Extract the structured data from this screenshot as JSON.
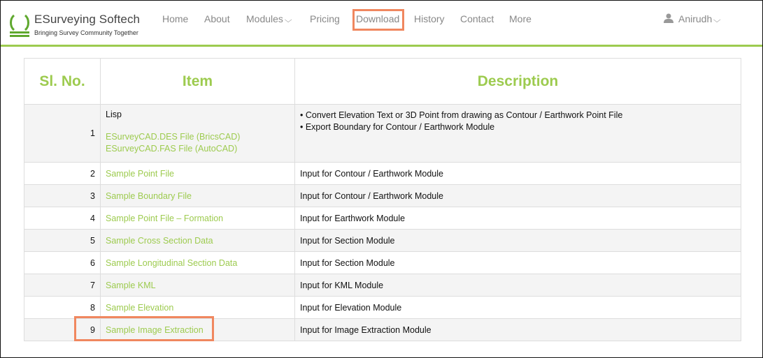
{
  "brand": {
    "title": "ESurveying Softech",
    "tagline": "Bringing Survey Community Together",
    "logo_icon": "omega-logo-icon",
    "accent_color": "#9dcb4f"
  },
  "nav": {
    "items": [
      {
        "label": "Home"
      },
      {
        "label": "About"
      },
      {
        "label": "Modules",
        "has_dropdown": true
      },
      {
        "label": "Pricing"
      },
      {
        "label": "Download",
        "highlighted": true
      },
      {
        "label": "History"
      },
      {
        "label": "Contact"
      },
      {
        "label": "More"
      }
    ],
    "user": {
      "name": "Anirudh",
      "icon": "user-icon",
      "has_dropdown": true
    },
    "chevron": "❯"
  },
  "table": {
    "headers": {
      "num": "Sl. No.",
      "item": "Item",
      "desc": "Description"
    },
    "first_row": {
      "num": "1",
      "label": "Lisp",
      "links": [
        "ESurveyCAD.DES File (BricsCAD)",
        "ESurveyCAD.FAS File (AutoCAD)"
      ],
      "desc": [
        "• Convert Elevation Text or 3D Point from drawing as Contour / Earthwork Point File",
        "• Export Boundary for Contour / Earthwork Module"
      ]
    },
    "rows": [
      {
        "num": "2",
        "item": "Sample Point File",
        "desc": "Input for Contour / Earthwork Module"
      },
      {
        "num": "3",
        "item": "Sample Boundary File",
        "desc": "Input for Contour / Earthwork Module"
      },
      {
        "num": "4",
        "item": "Sample Point File – Formation",
        "desc": "Input for Earthwork Module"
      },
      {
        "num": "5",
        "item": "Sample Cross Section Data",
        "desc": "Input for Section Module"
      },
      {
        "num": "6",
        "item": "Sample Longitudinal Section Data",
        "desc": "Input for Section Module"
      },
      {
        "num": "7",
        "item": "Sample KML",
        "desc": "Input for KML Module"
      },
      {
        "num": "8",
        "item": "Sample Elevation",
        "desc": "Input for Elevation Module"
      },
      {
        "num": "9",
        "item": "Sample Image Extraction",
        "desc": "Input for Image Extraction Module",
        "highlighted": true
      }
    ]
  },
  "highlight_color": "#f0875f"
}
